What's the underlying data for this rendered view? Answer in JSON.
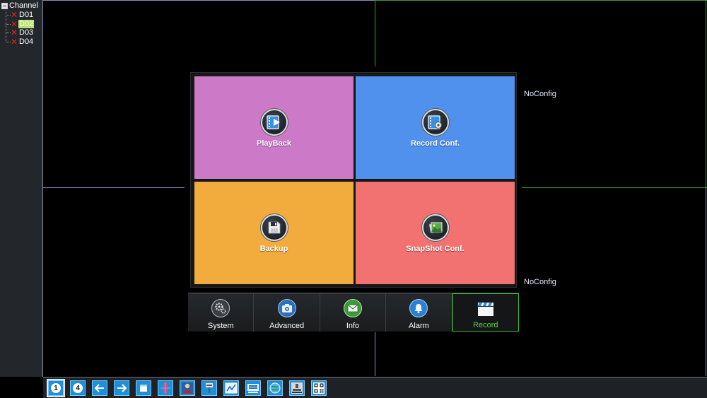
{
  "sidebar": {
    "root_label": "Channel",
    "channels": [
      {
        "label": "D01",
        "selected": false
      },
      {
        "label": "D02",
        "selected": true
      },
      {
        "label": "D03",
        "selected": false
      },
      {
        "label": "D04",
        "selected": false
      }
    ]
  },
  "video": {
    "noconfig_top": "NoConfig",
    "noconfig_bottom": "NoConfig"
  },
  "menu": {
    "tiles": [
      {
        "label": "PlayBack",
        "color": "#cc7ac8",
        "icon": "playback-icon"
      },
      {
        "label": "Record Conf.",
        "color": "#5091ee",
        "icon": "record-conf-icon"
      },
      {
        "label": "Backup",
        "color": "#f2ac3e",
        "icon": "save-icon"
      },
      {
        "label": "SnapShot Conf.",
        "color": "#f27272",
        "icon": "snapshot-icon"
      }
    ]
  },
  "tabs": {
    "items": [
      {
        "label": "System",
        "icon": "gear-icon",
        "active": false
      },
      {
        "label": "Advanced",
        "icon": "camera-icon",
        "active": false
      },
      {
        "label": "Info",
        "icon": "mail-icon",
        "active": false
      },
      {
        "label": "Alarm",
        "icon": "bell-icon",
        "active": false
      },
      {
        "label": "Record",
        "icon": "clapperboard-icon",
        "active": true
      }
    ]
  },
  "toolbar": {
    "single_view_label": "1",
    "quad_view_label": "4"
  },
  "colors": {
    "active_tab": "#3dbb3d",
    "toolbar_blue": "#1f8fd9"
  }
}
